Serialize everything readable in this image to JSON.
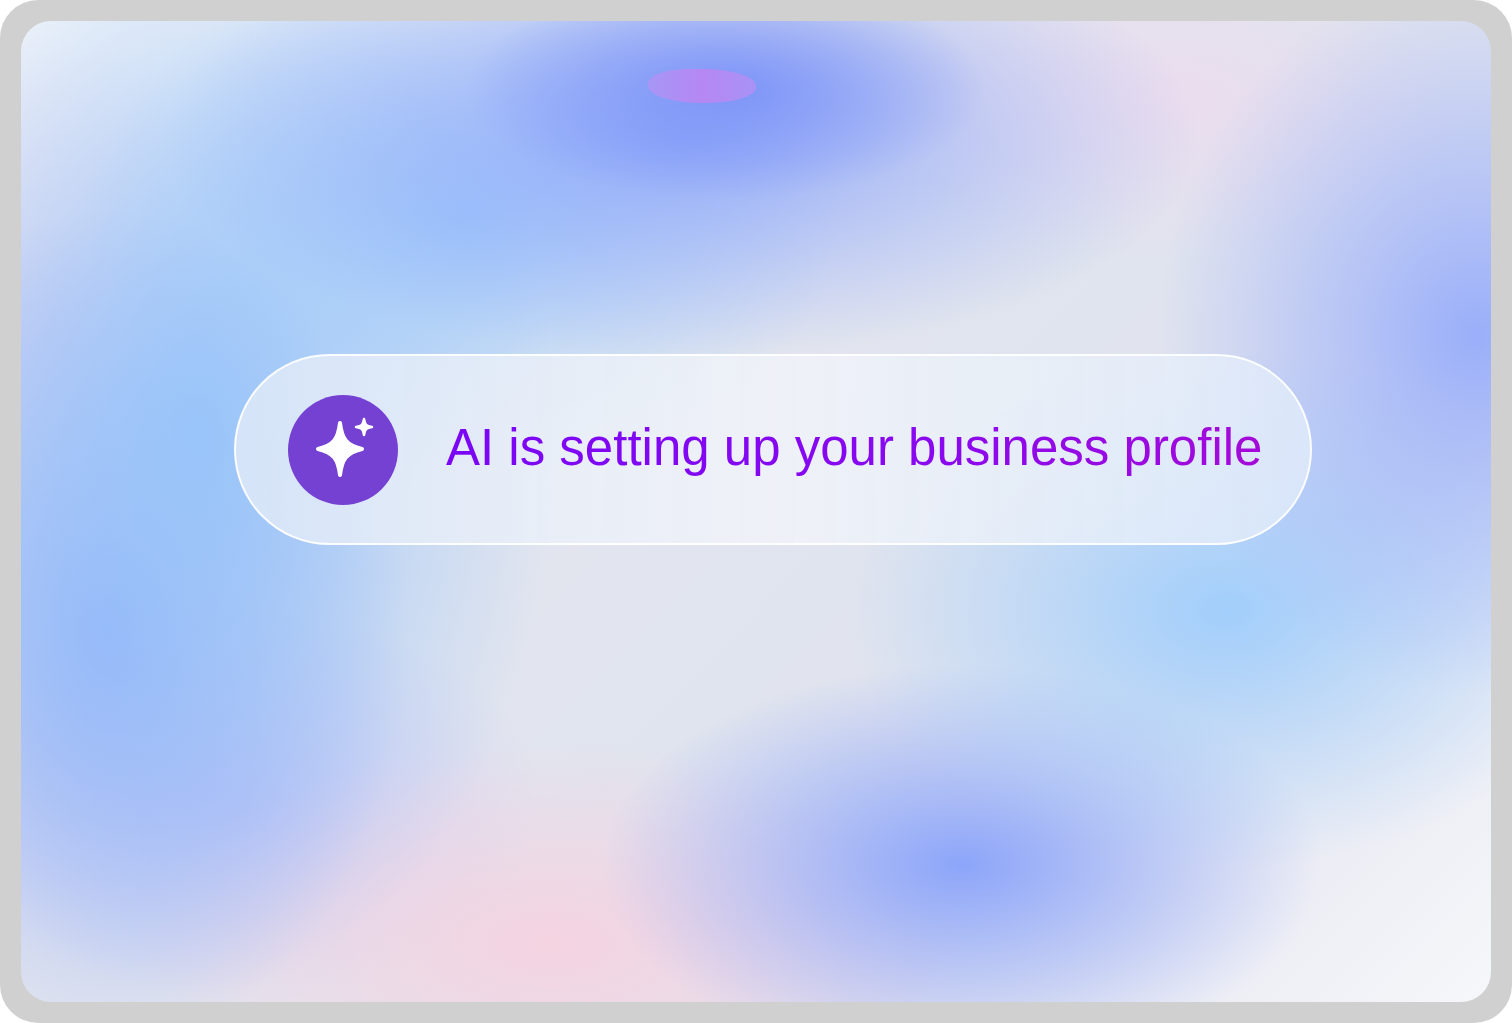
{
  "status": {
    "message": "AI is setting up your business profile"
  }
}
